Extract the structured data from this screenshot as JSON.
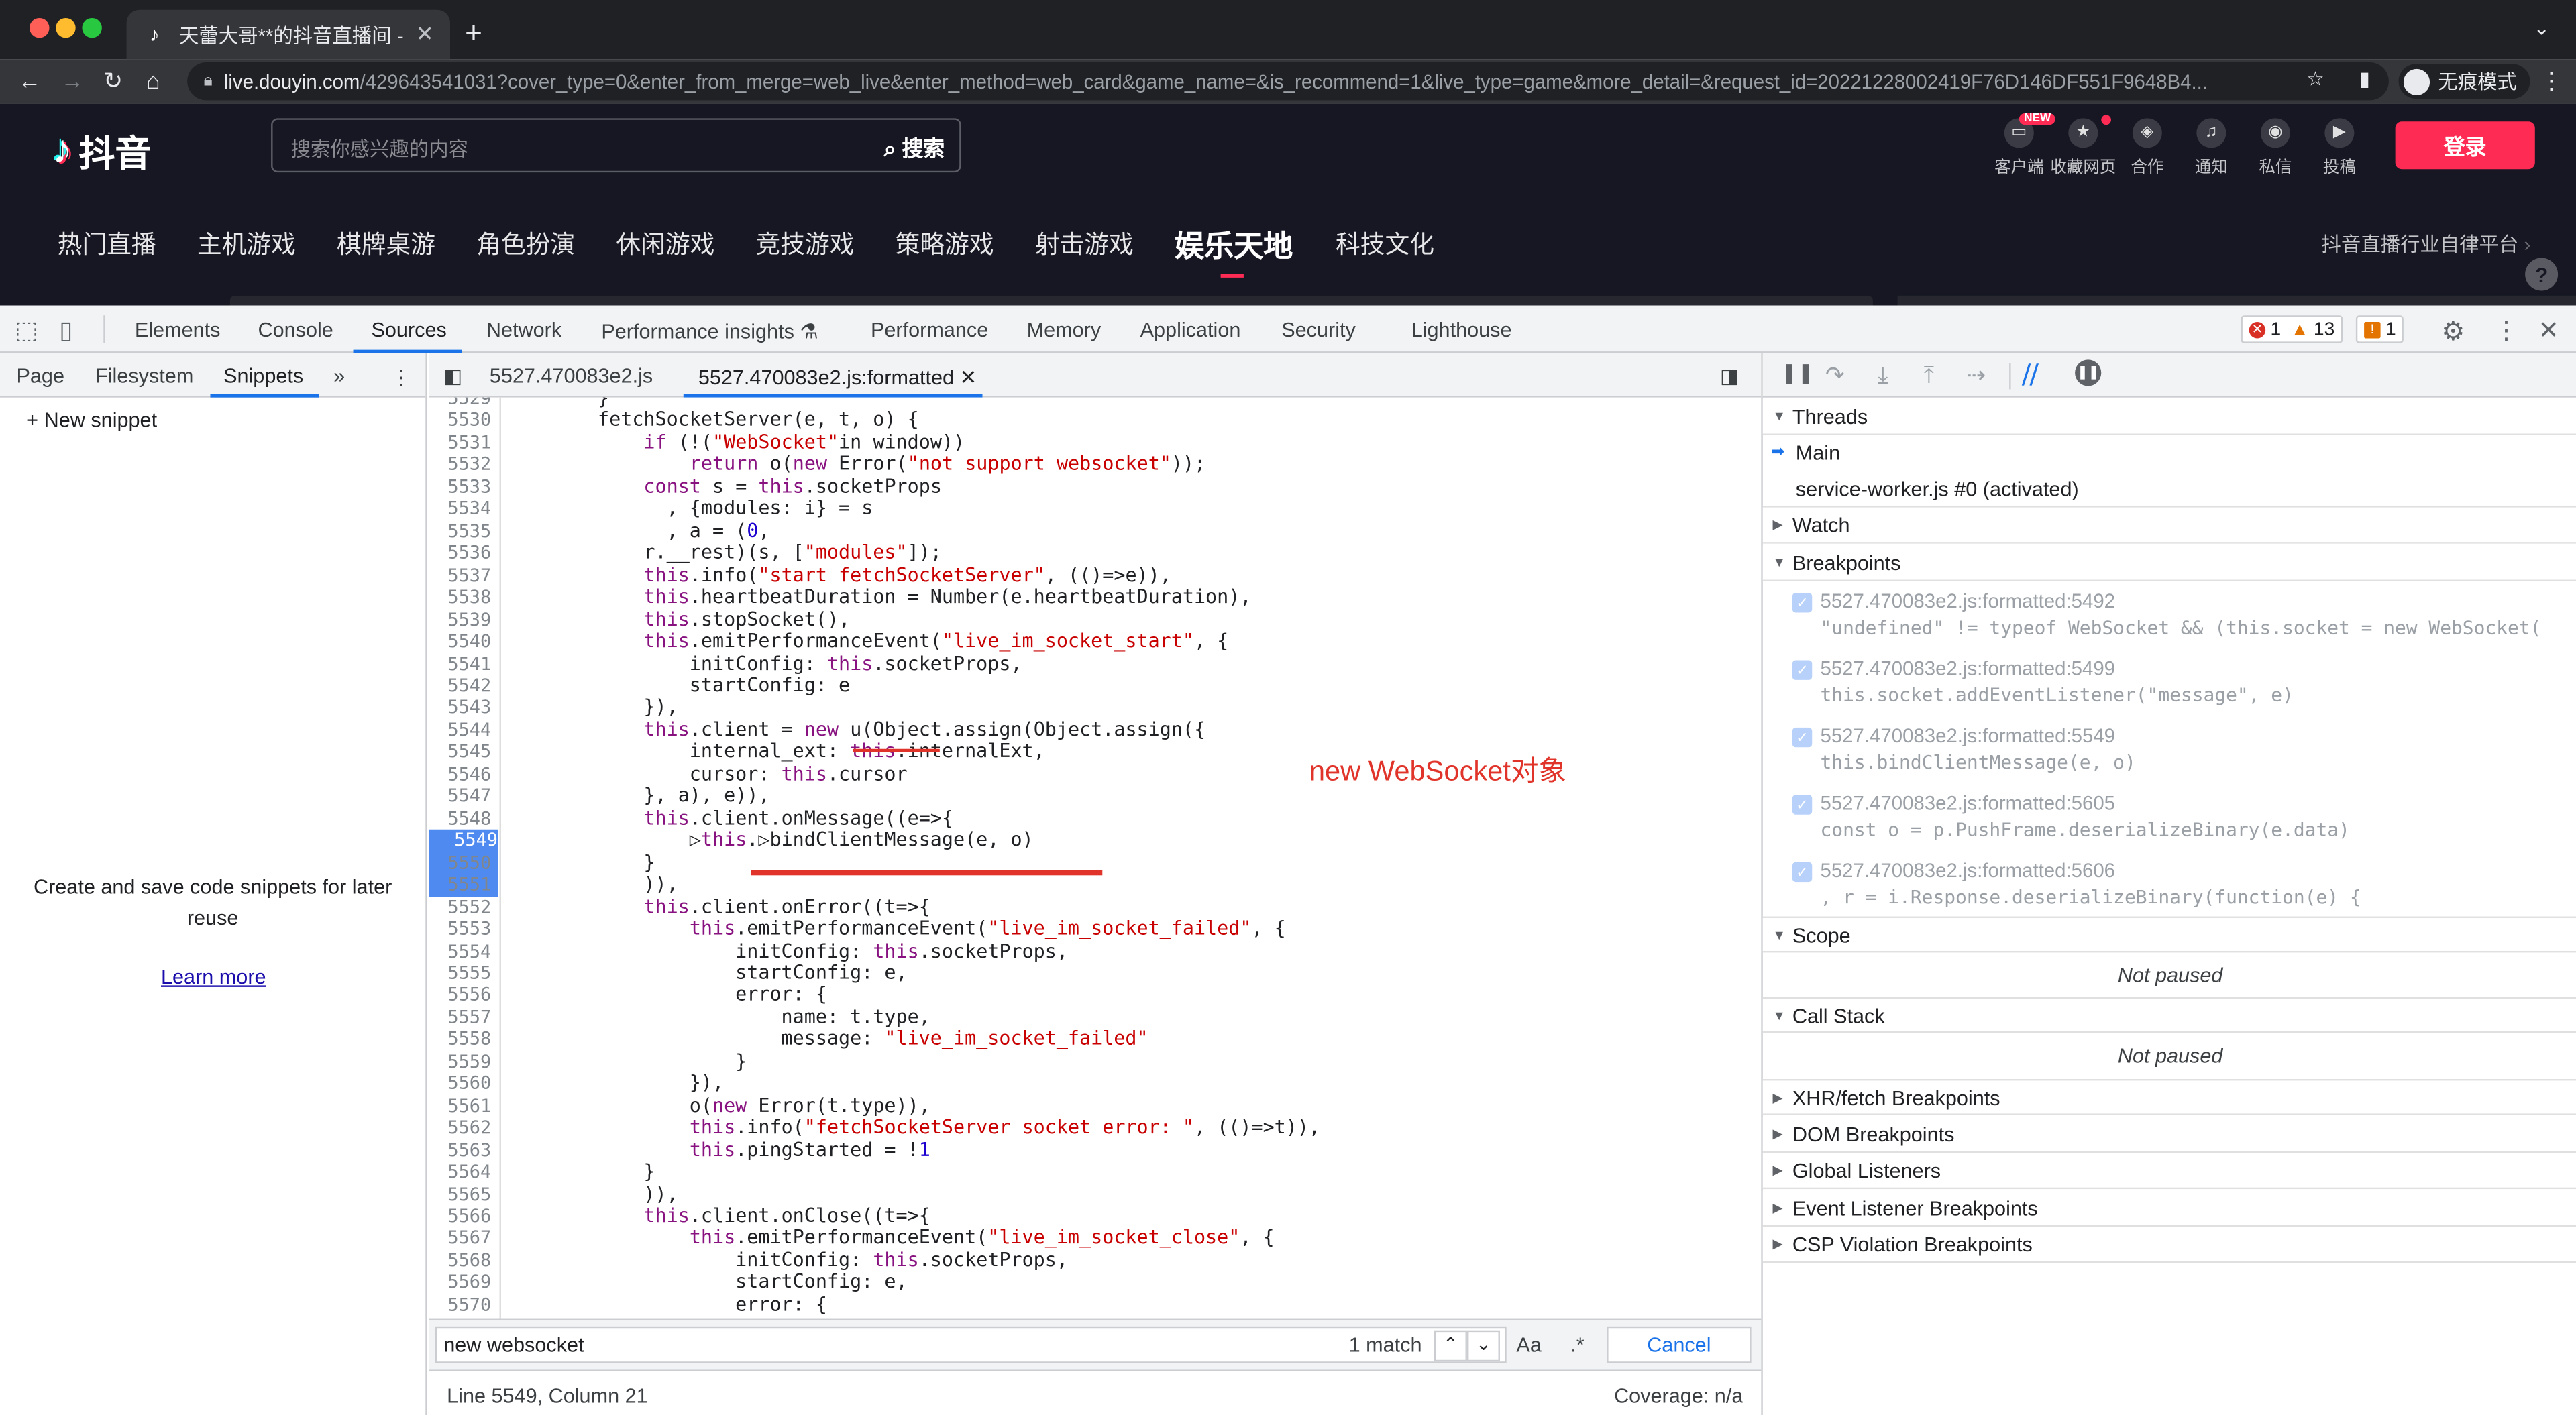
{
  "browser": {
    "tab_title": "天蕾大哥**的抖音直播间 - 抖音直",
    "new_tab": "+",
    "url_host": "live.douyin.com",
    "url_path": "/429643541031?cover_type=0&enter_from_merge=web_live&enter_method=web_card&game_name=&is_recommend=1&live_type=game&more_detail=&request_id=20221228002419F76D146DF551F9648B4...",
    "incognito": "无痕模式"
  },
  "site": {
    "logo": "抖音",
    "search_placeholder": "搜索你感兴趣的内容",
    "search_button": "搜索",
    "new_badge": "NEW",
    "top_icons": [
      "客户端",
      "收藏网页",
      "合作",
      "通知",
      "私信",
      "投稿"
    ],
    "login": "登录",
    "categories": [
      "热门直播",
      "主机游戏",
      "棋牌桌游",
      "角色扮演",
      "休闲游戏",
      "竞技游戏",
      "策略游戏",
      "射击游戏",
      "娱乐天地",
      "科技文化"
    ],
    "active_category": "娱乐天地",
    "platform_link": "抖音直播行业自律平台",
    "help": "?"
  },
  "devtools": {
    "tabs": [
      "Elements",
      "Console",
      "Sources",
      "Network",
      "Performance insights",
      "Performance",
      "Memory",
      "Application",
      "Security",
      "Lighthouse"
    ],
    "selected_tab": "Sources",
    "errors": "1",
    "warnings": "13",
    "messages": "1",
    "navigator_tabs": [
      "Page",
      "Filesystem",
      "Snippets"
    ],
    "more_tabs": "»",
    "new_snippet": "New snippet",
    "snippet_message": "Create and save code snippets for later reuse",
    "learn_more": "Learn more",
    "editor_tabs": [
      "5527.470083e2.js",
      "5527.470083e2.js:formatted"
    ],
    "annotation": "new WebSocket对象",
    "search_query": "new websocket",
    "match_count": "1 match",
    "match_case": "Aa",
    "regex": ".*",
    "cancel": "Cancel",
    "cursor_pos": "Line 5549, Column 21",
    "coverage": "Coverage: n/a",
    "code_lines": [
      {
        "n": "5529",
        "t": "        }"
      },
      {
        "n": "5530",
        "t": "        fetchSocketServer(e, t, o) {"
      },
      {
        "n": "5531",
        "t": "            if (!(\"WebSocket\"in window))"
      },
      {
        "n": "5532",
        "t": "                return o(new Error(\"not support websocket\"));"
      },
      {
        "n": "5533",
        "t": "            const s = this.socketProps"
      },
      {
        "n": "5534",
        "t": "              , {modules: i} = s"
      },
      {
        "n": "5535",
        "t": "              , a = (0,"
      },
      {
        "n": "5536",
        "t": "            r.__rest)(s, [\"modules\"]);"
      },
      {
        "n": "5537",
        "t": "            this.info(\"start fetchSocketServer\", (()=>e)),"
      },
      {
        "n": "5538",
        "t": "            this.heartbeatDuration = Number(e.heartbeatDuration),"
      },
      {
        "n": "5539",
        "t": "            this.stopSocket(),"
      },
      {
        "n": "5540",
        "t": "            this.emitPerformanceEvent(\"live_im_socket_start\", {"
      },
      {
        "n": "5541",
        "t": "                initConfig: this.socketProps,"
      },
      {
        "n": "5542",
        "t": "                startConfig: e"
      },
      {
        "n": "5543",
        "t": "            }),"
      },
      {
        "n": "5544",
        "t": "            this.client = new u(Object.assign(Object.assign({"
      },
      {
        "n": "5545",
        "t": "                internal_ext: this.internalExt,"
      },
      {
        "n": "5546",
        "t": "                cursor: this.cursor"
      },
      {
        "n": "5547",
        "t": "            }, a), e)),"
      },
      {
        "n": "5548",
        "t": "            this.client.onMessage((e=>{"
      },
      {
        "n": "5549",
        "t": "                ▷this.▷bindClientMessage(e, o)"
      },
      {
        "n": "5550",
        "t": "            }"
      },
      {
        "n": "5551",
        "t": "            )),"
      },
      {
        "n": "5552",
        "t": "            this.client.onError((t=>{"
      },
      {
        "n": "5553",
        "t": "                this.emitPerformanceEvent(\"live_im_socket_failed\", {"
      },
      {
        "n": "5554",
        "t": "                    initConfig: this.socketProps,"
      },
      {
        "n": "5555",
        "t": "                    startConfig: e,"
      },
      {
        "n": "5556",
        "t": "                    error: {"
      },
      {
        "n": "5557",
        "t": "                        name: t.type,"
      },
      {
        "n": "5558",
        "t": "                        message: \"live_im_socket_failed\""
      },
      {
        "n": "5559",
        "t": "                    }"
      },
      {
        "n": "5560",
        "t": "                }),"
      },
      {
        "n": "5561",
        "t": "                o(new Error(t.type)),"
      },
      {
        "n": "5562",
        "t": "                this.info(\"fetchSocketServer socket error: \", (()=>t)),"
      },
      {
        "n": "5563",
        "t": "                this.pingStarted = !1"
      },
      {
        "n": "5564",
        "t": "            }"
      },
      {
        "n": "5565",
        "t": "            )),"
      },
      {
        "n": "5566",
        "t": "            this.client.onClose((t=>{"
      },
      {
        "n": "5567",
        "t": "                this.emitPerformanceEvent(\"live_im_socket_close\", {"
      },
      {
        "n": "5568",
        "t": "                    initConfig: this.socketProps,"
      },
      {
        "n": "5569",
        "t": "                    startConfig: e,"
      },
      {
        "n": "5570",
        "t": "                    error: {"
      }
    ],
    "breakpoint_line": "5549",
    "debugger": {
      "threads": "Threads",
      "main": "Main",
      "sw": "service-worker.js #0 (activated)",
      "watch": "Watch",
      "breakpoints": "Breakpoints",
      "bp_list": [
        {
          "loc": "5527.470083e2.js:formatted:5492",
          "code": "\"undefined\" != typeof WebSocket && (this.socket = new WebSocket("
        },
        {
          "loc": "5527.470083e2.js:formatted:5499",
          "code": "this.socket.addEventListener(\"message\", e)"
        },
        {
          "loc": "5527.470083e2.js:formatted:5549",
          "code": "this.bindClientMessage(e, o)"
        },
        {
          "loc": "5527.470083e2.js:formatted:5605",
          "code": "const o = p.PushFrame.deserializeBinary(e.data)"
        },
        {
          "loc": "5527.470083e2.js:formatted:5606",
          "code": ", r = i.Response.deserializeBinary(function(e) {"
        }
      ],
      "scope": "Scope",
      "not_paused": "Not paused",
      "call_stack": "Call Stack",
      "others": [
        "XHR/fetch Breakpoints",
        "DOM Breakpoints",
        "Global Listeners",
        "Event Listener Breakpoints",
        "CSP Violation Breakpoints"
      ]
    }
  }
}
